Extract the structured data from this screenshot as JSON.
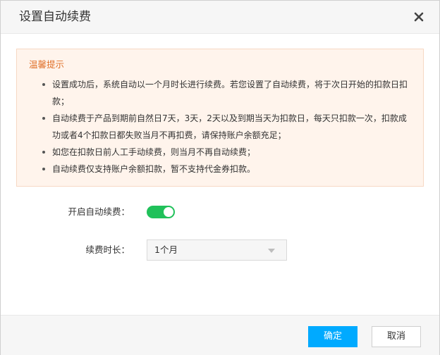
{
  "dialog": {
    "title": "设置自动续费",
    "close_icon": "close-icon"
  },
  "notice": {
    "title": "温馨提示",
    "items": [
      "设置成功后，系统自动以一个月时长进行续费。若您设置了自动续费，将于次日开始的扣款日扣款；",
      "自动续费于产品到期前自然日7天，3天，2天以及到期当天为扣款日，每天只扣款一次，扣款成功或者4个扣款日都失败当月不再扣费，请保持账户余额充足；",
      "如您在扣款日前人工手动续费，则当月不再自动续费；",
      "自动续费仅支持账户余额扣款，暂不支持代金券扣款。"
    ]
  },
  "form": {
    "auto_renew_label": "开启自动续费：",
    "auto_renew_on": true,
    "duration_label": "续费时长：",
    "duration_value": "1个月"
  },
  "footer": {
    "confirm_label": "确定",
    "cancel_label": "取消"
  },
  "colors": {
    "notice_title": "#e0712a",
    "notice_bg": "#fff4ec",
    "toggle_on": "#20c15a",
    "primary": "#00aaff"
  }
}
